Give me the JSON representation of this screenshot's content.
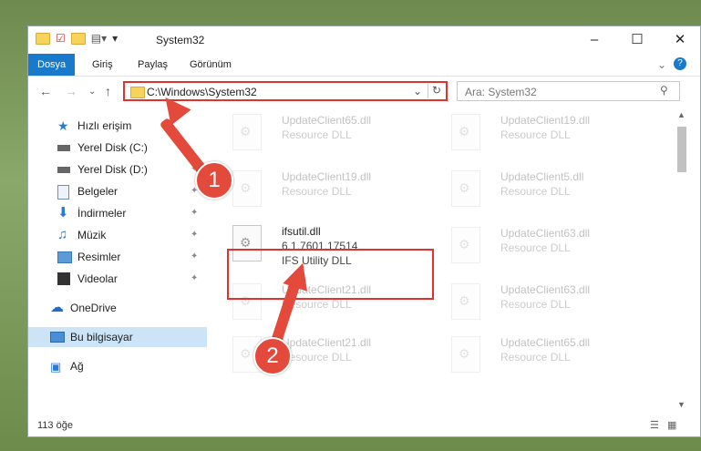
{
  "window": {
    "title": "System32"
  },
  "ribbon": {
    "tabs": [
      "Dosya",
      "Giriş",
      "Paylaş",
      "Görünüm"
    ]
  },
  "address": {
    "path": "C:\\Windows\\System32"
  },
  "search": {
    "placeholder": "Ara: System32"
  },
  "sidebar": {
    "items": [
      {
        "label": "Hızlı erişim"
      },
      {
        "label": "Yerel Disk (C:)"
      },
      {
        "label": "Yerel Disk (D:)"
      },
      {
        "label": "Belgeler"
      },
      {
        "label": "İndirmeler"
      },
      {
        "label": "Müzik"
      },
      {
        "label": "Resimler"
      },
      {
        "label": "Videolar"
      },
      {
        "label": "OneDrive"
      },
      {
        "label": "Bu bilgisayar"
      },
      {
        "label": "Ağ"
      }
    ]
  },
  "files": [
    {
      "name": "UpdateClient65.dll",
      "desc": "Resource DLL"
    },
    {
      "name": "UpdateClient19.dll",
      "desc": "Resource DLL"
    },
    {
      "name": "UpdateClient19.dll",
      "desc": "Resource DLL"
    },
    {
      "name": "UpdateClient5.dll",
      "desc": "Resource DLL"
    },
    {
      "name": "ifsutil.dll",
      "version": "6.1.7601.17514",
      "desc": "IFS Utility DLL"
    },
    {
      "name": "UpdateClient63.dll",
      "desc": "Resource DLL"
    },
    {
      "name": "UpdateClient21.dll",
      "desc": "Resource DLL"
    },
    {
      "name": "UpdateClient63.dll",
      "desc": "Resource DLL"
    },
    {
      "name": "UpdateClient21.dll",
      "desc": "Resource DLL"
    },
    {
      "name": "UpdateClient65.dll",
      "desc": "Resource DLL"
    }
  ],
  "status": {
    "count": "113 öğe"
  },
  "annotations": {
    "badge1": "1",
    "badge2": "2"
  },
  "colors": {
    "accent": "#1979ca",
    "highlight": "#e1322d"
  }
}
